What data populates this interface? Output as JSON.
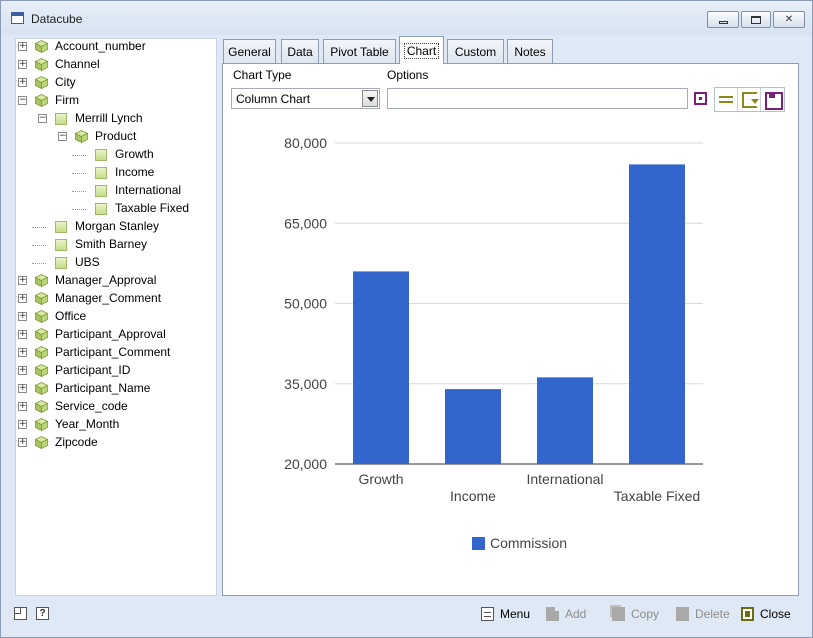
{
  "window": {
    "title": "Datacube"
  },
  "tree": {
    "items": [
      {
        "label": "Account_number",
        "icon": "cube-icon",
        "expander": "+"
      },
      {
        "label": "Channel",
        "icon": "cube-icon",
        "expander": "+"
      },
      {
        "label": "City",
        "icon": "cube-icon",
        "expander": "+"
      },
      {
        "label": "Firm",
        "icon": "cube-icon",
        "expander": "-"
      },
      {
        "label": "Merrill Lynch",
        "icon": "leaf-icon",
        "expander": "-"
      },
      {
        "label": "Product",
        "icon": "cube-icon",
        "expander": "-"
      },
      {
        "label": "Growth",
        "icon": "leaf-icon",
        "expander": ""
      },
      {
        "label": "Income",
        "icon": "leaf-icon",
        "expander": ""
      },
      {
        "label": "International",
        "icon": "leaf-icon",
        "expander": ""
      },
      {
        "label": "Taxable Fixed",
        "icon": "leaf-icon",
        "expander": ""
      },
      {
        "label": "Morgan Stanley",
        "icon": "leaf-icon",
        "expander": ""
      },
      {
        "label": "Smith Barney",
        "icon": "leaf-icon",
        "expander": ""
      },
      {
        "label": "UBS",
        "icon": "leaf-icon",
        "expander": ""
      },
      {
        "label": "Manager_Approval",
        "icon": "cube-icon",
        "expander": "+"
      },
      {
        "label": "Manager_Comment",
        "icon": "cube-icon",
        "expander": "+"
      },
      {
        "label": "Office",
        "icon": "cube-icon",
        "expander": "+"
      },
      {
        "label": "Participant_Approval",
        "icon": "cube-icon",
        "expander": "+"
      },
      {
        "label": "Participant_Comment",
        "icon": "cube-icon",
        "expander": "+"
      },
      {
        "label": "Participant_ID",
        "icon": "cube-icon",
        "expander": "+"
      },
      {
        "label": "Participant_Name",
        "icon": "cube-icon",
        "expander": "+"
      },
      {
        "label": "Service_code",
        "icon": "cube-icon",
        "expander": "+"
      },
      {
        "label": "Year_Month",
        "icon": "cube-icon",
        "expander": "+"
      },
      {
        "label": "Zipcode",
        "icon": "cube-icon",
        "expander": "+"
      }
    ]
  },
  "tabs": [
    {
      "label": "General",
      "active": false
    },
    {
      "label": "Data",
      "active": false
    },
    {
      "label": "Pivot Table",
      "active": false
    },
    {
      "label": "Chart",
      "active": true
    },
    {
      "label": "Custom",
      "active": false
    },
    {
      "label": "Notes",
      "active": false
    }
  ],
  "chart_panel": {
    "chart_type_label": "Chart Type",
    "chart_type_value": "Column Chart",
    "options_label": "Options",
    "options_value": ""
  },
  "chart_data": {
    "type": "bar",
    "categories": [
      "Growth",
      "Income",
      "International",
      "Taxable Fixed"
    ],
    "series": [
      {
        "name": "Commission",
        "values": [
          56000,
          34000,
          36200,
          76000
        ],
        "color": "#3366cc"
      }
    ],
    "yticks": [
      "20,000",
      "35,000",
      "50,000",
      "65,000",
      "80,000"
    ],
    "ylim": [
      20000,
      80000
    ],
    "grid": true,
    "legend": "bottom",
    "title": "",
    "xlabel": "",
    "ylabel": ""
  },
  "footer": {
    "menu_label": "Menu",
    "add_label": "Add",
    "copy_label": "Copy",
    "delete_label": "Delete",
    "close_label": "Close"
  }
}
